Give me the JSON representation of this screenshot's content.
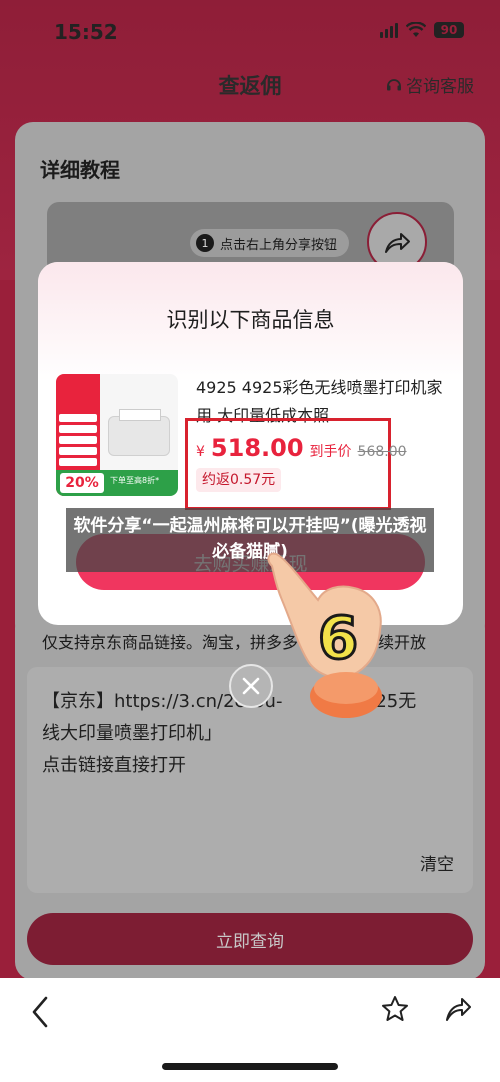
{
  "status_bar": {
    "time": "15:52",
    "battery": "90"
  },
  "nav": {
    "title": "查返佣",
    "help_label": "咨询客服"
  },
  "tutorial": {
    "title": "详细教程",
    "tip_number": "1",
    "tip_text": "点击右上角分享按钮"
  },
  "modal": {
    "title": "识别以下商品信息",
    "product": {
      "name": "4925   4925彩色无线喷墨打印机家用 大印量低成本照…",
      "price_symbol": "¥",
      "price": "518.00",
      "price_label": "到手价",
      "original_price": "568.00",
      "rebate": "约返0.57元",
      "thumb_discount": "20%",
      "thumb_promo": "下单至高8折*"
    },
    "buy_button": "去购买赚返现"
  },
  "caption": "软件分享“一起温州麻将可以开挂吗”(曝光透视必备猫腻)",
  "sticker_number": "6",
  "lower": {
    "notice": "仅支持京东商品链接。淘宝，拼多多等平台会陆续开放",
    "link_text_line1": "【京东】https://3.cn/2eTou-",
    "link_text_suffix": "4925无",
    "link_text_line2": "线大印量喷墨打印机」",
    "link_text_line3": "点击链接直接打开",
    "clear_label": "清空",
    "query_button": "立即查询"
  },
  "colors": {
    "accent": "#f0365f",
    "price_red": "#e8233d",
    "price_frame": "#d8222e"
  }
}
